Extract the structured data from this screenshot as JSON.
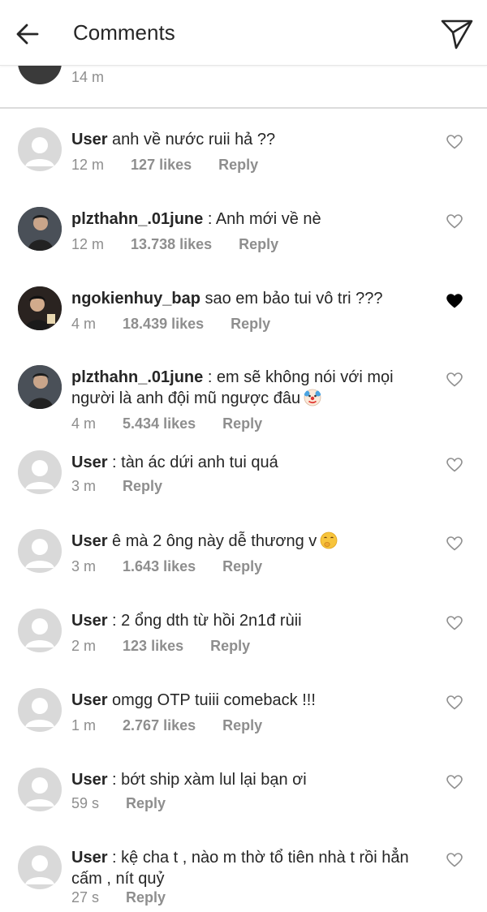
{
  "header": {
    "title": "Comments",
    "back_icon": "arrow-left-icon",
    "send_icon": "paper-plane-icon"
  },
  "previous": {
    "time": "14 m"
  },
  "comments": [
    {
      "user": "User",
      "text": "anh về nước ruii hả ??",
      "time": "12 m",
      "likes": "127 likes",
      "reply": "Reply",
      "avatar": "default",
      "liked": false
    },
    {
      "user": "plzthahn_.01june",
      "text": ": Anh mới về nè",
      "time": "12 m",
      "likes": "13.738 likes",
      "reply": "Reply",
      "avatar": "photo",
      "liked": false
    },
    {
      "user": "ngokienhuy_bap",
      "text": "sao em bảo tui vô tri ???",
      "time": "4 m",
      "likes": "18.439 likes",
      "reply": "Reply",
      "avatar": "photo",
      "liked": true
    },
    {
      "user": "plzthahn_.01june",
      "text": ": em sẽ không nói với mọi người là anh đội mũ ngược đâu",
      "time": "4 m",
      "likes": "5.434 likes",
      "reply": "Reply",
      "avatar": "photo",
      "liked": false,
      "emoji": "clown-face"
    },
    {
      "user": "User",
      "text": ": tàn ác dứi anh tui quá",
      "time": "3 m",
      "likes": "",
      "reply": "Reply",
      "avatar": "default",
      "liked": false
    },
    {
      "user": "User",
      "text": "ê mà 2 ông này dễ thương v",
      "time": "3 m",
      "likes": "1.643 likes",
      "reply": "Reply",
      "avatar": "default",
      "liked": false,
      "emoji": "shushing-face"
    },
    {
      "user": "User",
      "text": ": 2 ổng dth từ hồi 2n1đ rùii",
      "time": "2 m",
      "likes": "123 likes",
      "reply": "Reply",
      "avatar": "default",
      "liked": false
    },
    {
      "user": "User",
      "text": "omgg OTP tuiii comeback !!!",
      "time": "1 m",
      "likes": "2.767 likes",
      "reply": "Reply",
      "avatar": "default",
      "liked": false
    },
    {
      "user": "User",
      "text": ": bớt ship xàm lul lại bạn ơi",
      "time": "59 s",
      "likes": "",
      "reply": "Reply",
      "avatar": "default",
      "liked": false
    },
    {
      "user": "User",
      "text": ": kệ cha t , nào m thờ tổ tiên nhà t rồi hẳn cấm , nít quỷ",
      "time": "27 s",
      "likes": "",
      "reply": "Reply",
      "avatar": "default",
      "liked": false
    }
  ]
}
